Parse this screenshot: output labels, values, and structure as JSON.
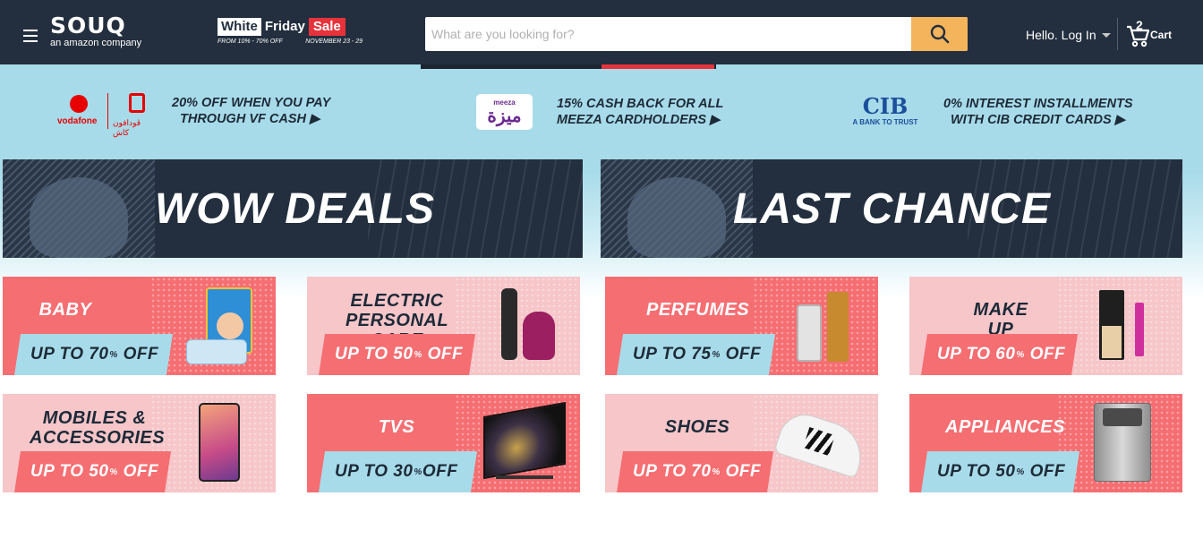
{
  "header": {
    "logo": "SOUQ",
    "logo_sub": "an amazon company",
    "sale": {
      "word1": "White",
      "word2": "Friday",
      "word3": "Sale",
      "discount": "FROM 10% - 70% OFF",
      "dates": "NOVEMBER 23 - 29"
    },
    "search_placeholder": "What are you looking for?",
    "login_label": "Hello. Log In",
    "cart_count": "2",
    "cart_label": "Cart"
  },
  "promos": [
    {
      "brand": "vodafone",
      "brand_ar": "ڤودافون كاش",
      "text_line1": "20% OFF WHEN YOU PAY",
      "text_line2": "THROUGH VF CASH ▶"
    },
    {
      "brand": "meeza",
      "brand_ar": "ميزة",
      "text_line1": "15% CASH BACK FOR ALL",
      "text_line2": "MEEZA CARDHOLDERS ▶"
    },
    {
      "brand": "CIB",
      "tagline": "A BANK TO TRUST",
      "text_line1": "0% INTEREST INSTALLMENTS",
      "text_line2": "WITH CIB CREDIT CARDS ▶"
    }
  ],
  "banners": [
    {
      "title": "WOW DEALS"
    },
    {
      "title": "LAST CHANCE"
    }
  ],
  "categories": [
    {
      "name_line1": "BABY",
      "name_line2": "",
      "offer": "UP TO 70",
      "unit": "%",
      "off": "OFF"
    },
    {
      "name_line1": "ELECTRIC",
      "name_line2": "PERSONAL CARE",
      "offer": "UP TO 50",
      "unit": "%",
      "off": "OFF"
    },
    {
      "name_line1": "PERFUMES",
      "name_line2": "",
      "offer": "UP TO 75",
      "unit": "%",
      "off": "OFF"
    },
    {
      "name_line1": "MAKE UP",
      "name_line2": "",
      "offer": "UP TO 60",
      "unit": "%",
      "off": "OFF"
    },
    {
      "name_line1": "MOBILES &",
      "name_line2": "ACCESSORIES",
      "offer": "UP TO 50",
      "unit": "%",
      "off": "OFF"
    },
    {
      "name_line1": "TVS",
      "name_line2": "",
      "offer": "UP TO 30",
      "unit": "%",
      "off": "OFF"
    },
    {
      "name_line1": "SHOES",
      "name_line2": "",
      "offer": "UP TO 70",
      "unit": "%",
      "off": "OFF"
    },
    {
      "name_line1": "APPLIANCES",
      "name_line2": "",
      "offer": "UP TO 50",
      "unit": "%",
      "off": "OFF"
    }
  ],
  "colors": {
    "header_bg": "#232f3e",
    "search_button": "#f4b45c",
    "coral": "#f56e72",
    "pink": "#f6c6c9",
    "sky": "#a8dbe9",
    "sale_red": "#e6333b"
  }
}
